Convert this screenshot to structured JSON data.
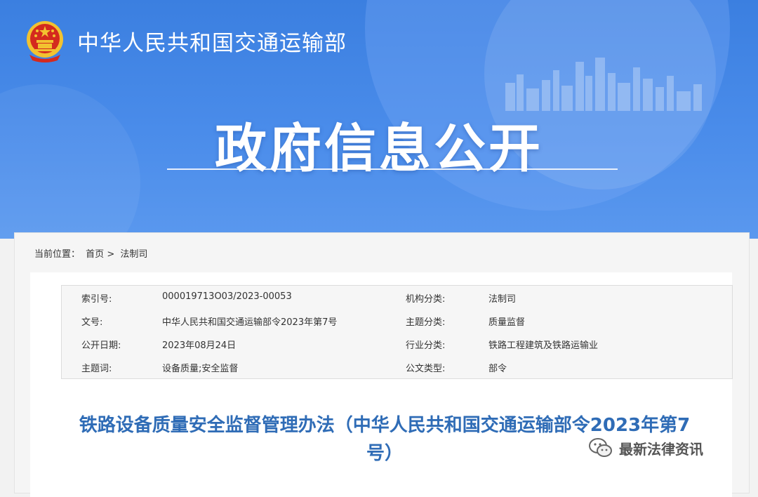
{
  "header": {
    "ministry_name": "中华人民共和国交通运输部",
    "banner_title": "政府信息公开"
  },
  "breadcrumb": {
    "label": "当前位置：",
    "items": [
      "首页",
      "法制司"
    ],
    "separator": ">"
  },
  "meta": {
    "rows": [
      {
        "k1": "索引号:",
        "v1": "000019713O03/2023-00053",
        "k2": "机构分类:",
        "v2": "法制司"
      },
      {
        "k1": "文号:",
        "v1": "中华人民共和国交通运输部令2023年第7号",
        "k2": "主题分类:",
        "v2": "质量监督"
      },
      {
        "k1": "公开日期:",
        "v1": "2023年08月24日",
        "k2": "行业分类:",
        "v2": "铁路工程建筑及铁路运输业"
      },
      {
        "k1": "主题词:",
        "v1": "设备质量;安全监督",
        "k2": "公文类型:",
        "v2": "部令"
      }
    ]
  },
  "document": {
    "title_line1": "铁路设备质量安全监督管理办法（中华人民共和国交通运输部令2023年第7",
    "title_line2": "号）"
  },
  "watermark": {
    "text": "最新法律资讯",
    "icon": "wechat-icon"
  },
  "colors": {
    "banner_blue": "#4a8cea",
    "title_blue": "#2f6cb6",
    "emblem_red": "#d42a1e",
    "emblem_gold": "#f2c230"
  }
}
